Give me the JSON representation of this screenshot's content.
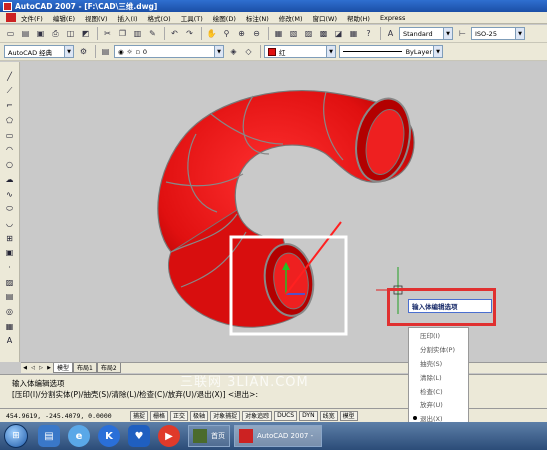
{
  "window": {
    "title": "AutoCAD 2007 - [F:\\CAD\\三维.dwg]"
  },
  "menu": {
    "items": [
      "文件(F)",
      "编辑(E)",
      "视图(V)",
      "插入(I)",
      "格式(O)",
      "工具(T)",
      "绘图(D)",
      "标注(N)",
      "修改(M)",
      "窗口(W)",
      "帮助(H)",
      "Express"
    ]
  },
  "toolbar": {
    "text_style": "Standard",
    "dim_style": "ISO-25",
    "workspace": "AutoCAD 经典",
    "layer_value": "0",
    "color_value": "红",
    "linetype_value": "ByLayer"
  },
  "tabs": [
    "模型",
    "布局1",
    "布局2"
  ],
  "command": {
    "line1": "输入体编辑选项",
    "line2": "[压印(I)/分割实体(P)/抽壳(S)/清除(L)/检查(C)/放弃(U)/退出(X)] <退出>:"
  },
  "status": {
    "coords": "454.9619, -245.4079, 0.0000",
    "buttons": [
      "捕捉",
      "栅格",
      "正交",
      "极轴",
      "对象捕捉",
      "对象追踪",
      "DUCS",
      "DYN",
      "线宽",
      "模型"
    ]
  },
  "prompt": {
    "label": "输入体编辑选项"
  },
  "context_menu": {
    "items": [
      "压印(I)",
      "分割实体(P)",
      "抽壳(S)",
      "清除(L)",
      "检查(C)",
      "放弃(U)",
      "退出(X)"
    ],
    "selected_index": 6
  },
  "taskbar": {
    "task1": "首页",
    "task2": "AutoCAD 2007 -"
  },
  "watermark": "三联网 3LIAN.COM",
  "colors": {
    "solid": "#e01010",
    "highlight_box": "#ffffff",
    "annotation": "#e03030"
  }
}
